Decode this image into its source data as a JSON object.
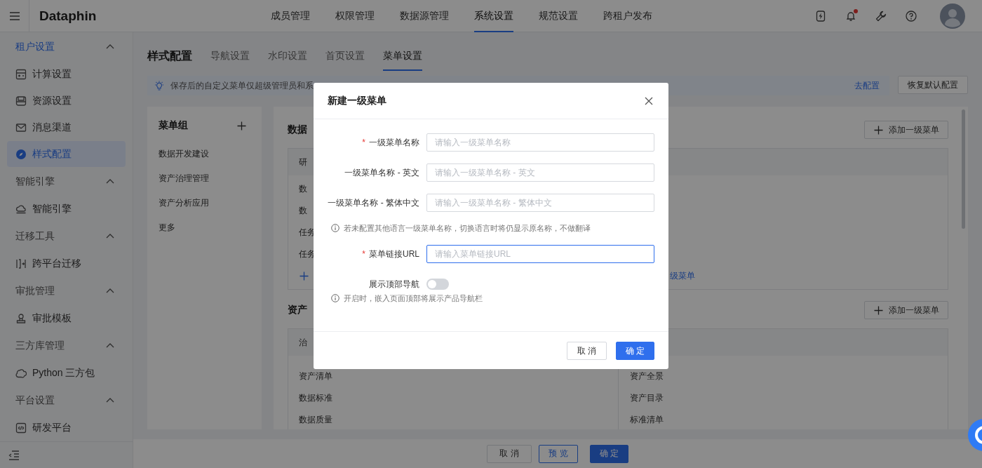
{
  "header": {
    "logo": "Dataphin",
    "has_notification": true,
    "nav": [
      {
        "label": "成员管理",
        "selected": false
      },
      {
        "label": "权限管理",
        "selected": false
      },
      {
        "label": "数据源管理",
        "selected": false
      },
      {
        "label": "系统设置",
        "selected": true
      },
      {
        "label": "规范设置",
        "selected": false
      },
      {
        "label": "跨租户发布",
        "selected": false
      }
    ]
  },
  "sidebar": {
    "groups": [
      {
        "title": "租户设置",
        "selected": true,
        "expanded": true,
        "items": [
          {
            "label": "计算设置",
            "selected": false
          },
          {
            "label": "资源设置",
            "selected": false
          },
          {
            "label": "消息渠道",
            "selected": false
          },
          {
            "label": "样式配置",
            "selected": true
          }
        ]
      },
      {
        "title": "智能引擎",
        "selected": false,
        "expanded": true,
        "items": [
          {
            "label": "智能引擎",
            "selected": false
          }
        ]
      },
      {
        "title": "迁移工具",
        "selected": false,
        "expanded": true,
        "items": [
          {
            "label": "跨平台迁移",
            "selected": false
          }
        ]
      },
      {
        "title": "审批管理",
        "selected": false,
        "expanded": true,
        "items": [
          {
            "label": "审批模板",
            "selected": false
          }
        ]
      },
      {
        "title": "三方库管理",
        "selected": false,
        "expanded": true,
        "items": [
          {
            "label": "Python 三方包",
            "selected": false
          }
        ]
      },
      {
        "title": "平台设置",
        "selected": false,
        "expanded": true,
        "items": [
          {
            "label": "研发平台",
            "selected": false
          }
        ]
      }
    ]
  },
  "page": {
    "title": "样式配置",
    "tabs": [
      {
        "label": "导航设置",
        "selected": false
      },
      {
        "label": "水印设置",
        "selected": false
      },
      {
        "label": "首页设置",
        "selected": false
      },
      {
        "label": "菜单设置",
        "selected": true
      }
    ]
  },
  "notice": {
    "text": "保存后的自定义菜单仅超级管理员和系",
    "link": "去配置"
  },
  "reset_button": "恢复默认配置",
  "menu_groups": {
    "title": "菜单组",
    "items": [
      "数据开发建设",
      "资产治理管理",
      "资产分析应用",
      "更多"
    ]
  },
  "sections": [
    {
      "title": "数据",
      "add_button": "添加一级菜单",
      "columns": [
        {
          "header": "研",
          "rows": [
            "数",
            "数",
            "任务",
            "任务"
          ],
          "add_link": {
            "kind": "icon_only"
          }
        },
        {
          "add_link": {
            "kind": "tail",
            "text": "级菜单"
          }
        }
      ]
    },
    {
      "title": "资产",
      "add_button": "添加一级菜单",
      "columns": [
        {
          "header": "治",
          "rows": [
            "资产清单",
            "数据标准",
            "数据质量"
          ]
        },
        {
          "rows": [
            "资产全景",
            "资产目录",
            "标准清单"
          ]
        }
      ]
    }
  ],
  "footer": {
    "buttons": [
      {
        "label": "取 消",
        "kind": "default"
      },
      {
        "label": "预 览",
        "kind": "outline"
      },
      {
        "label": "确 定",
        "kind": "primary"
      }
    ]
  },
  "dialog": {
    "title": "新建一级菜单",
    "required_mark": "*",
    "fields": [
      {
        "kind": "input",
        "label": "一级菜单名称",
        "required": true,
        "placeholder": "请输入一级菜单名称",
        "focused": false
      },
      {
        "kind": "input",
        "label": "一级菜单名称 - 英文",
        "required": false,
        "placeholder": "请输入一级菜单名称 - 英文",
        "focused": false
      },
      {
        "kind": "input",
        "label": "一级菜单名称 - 繁体中文",
        "required": false,
        "placeholder": "请输入一级菜单名称 - 繁体中文",
        "focused": false
      },
      {
        "kind": "note",
        "text": "若未配置其他语言一级菜单名称，切换语言时将仍显示原名称，不做翻译"
      },
      {
        "kind": "input",
        "label": "菜单链接URL",
        "required": true,
        "placeholder": "请输入菜单链接URL",
        "focused": true
      },
      {
        "kind": "switch",
        "label": "展示顶部导航",
        "on": false
      },
      {
        "kind": "note",
        "text": "开启时，嵌入页面顶部将展示产品导航栏"
      }
    ],
    "buttons": [
      {
        "label": "取 消",
        "kind": "default"
      },
      {
        "label": "确 定",
        "kind": "primary"
      }
    ]
  }
}
